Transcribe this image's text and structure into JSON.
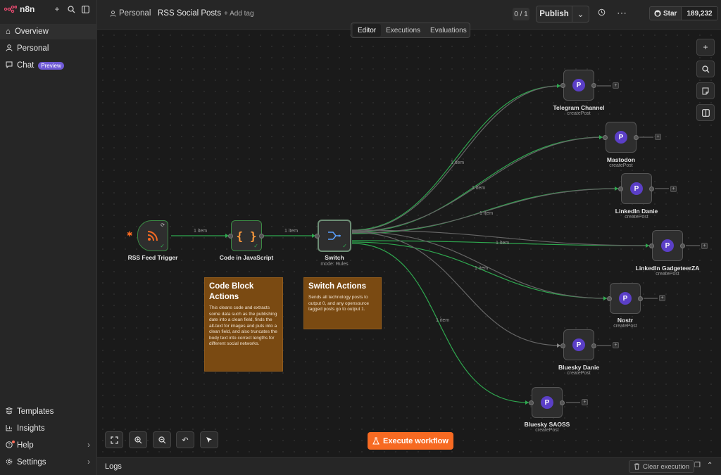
{
  "app": {
    "name": "n8n"
  },
  "sidebar": {
    "items": [
      {
        "label": "Overview",
        "icon": "home-icon"
      },
      {
        "label": "Personal",
        "icon": "user-icon"
      },
      {
        "label": "Chat",
        "icon": "chat-icon",
        "badge": "Preview"
      }
    ],
    "bottom_items": [
      {
        "label": "Templates",
        "icon": "templates-icon"
      },
      {
        "label": "Insights",
        "icon": "insights-icon"
      },
      {
        "label": "Help",
        "icon": "help-icon"
      },
      {
        "label": "Settings",
        "icon": "settings-icon"
      }
    ]
  },
  "header": {
    "project": "Personal",
    "workflow_title": "RSS Social Posts",
    "add_tag": "+ Add tag",
    "counter": "0 / 1",
    "publish": "Publish",
    "star": "Star",
    "star_count": "189,232"
  },
  "tabs": [
    "Editor",
    "Executions",
    "Evaluations"
  ],
  "nodes": {
    "rss": {
      "label": "RSS Feed Trigger"
    },
    "code": {
      "label": "Code in JavaScript"
    },
    "switch": {
      "label": "Switch",
      "sub": "mode: Rules"
    },
    "telegram": {
      "label": "Telegram Channel",
      "sub": "createPost"
    },
    "mastodon": {
      "label": "Mastodon",
      "sub": "createPost"
    },
    "linkedin_danie": {
      "label": "LinkedIn Danie",
      "sub": "createPost"
    },
    "linkedin_gz": {
      "label": "LinkedIn GadgeteerZA",
      "sub": "createPost"
    },
    "nostr": {
      "label": "Nostr",
      "sub": "createPost"
    },
    "bluesky_danie": {
      "label": "Bluesky Danie",
      "sub": "createPost"
    },
    "bluesky_saoss": {
      "label": "Bluesky SAOSS",
      "sub": "createPost"
    }
  },
  "edge_labels": {
    "rss_code": "1 item",
    "code_switch": "1 item",
    "telegram": "1 item",
    "mastodon": "1 item",
    "linkedin_danie": "1 item",
    "linkedin_gz": "1 item",
    "nostr": "1 item",
    "bluesky_saoss": "1 item"
  },
  "stickies": {
    "code_block": {
      "title": "Code Block Actions",
      "body": "This cleans code and extracts some data such as the publishing date into a clean field, finds the alt-text for images and puts into a clean field, and also truncates the body text into correct lengths for different social networks."
    },
    "switch_actions": {
      "title": "Switch Actions",
      "body": "Sends all technology posts to output 0, and any opensource tagged posts go to output 1."
    }
  },
  "execute_button": "Execute workflow",
  "logs": {
    "label": "Logs",
    "clear": "Clear execution"
  },
  "colors": {
    "accent": "#f76a22",
    "edge_green": "#2fa84f",
    "sticky": "#7a4a12",
    "postiz": "#5b3fc7"
  }
}
